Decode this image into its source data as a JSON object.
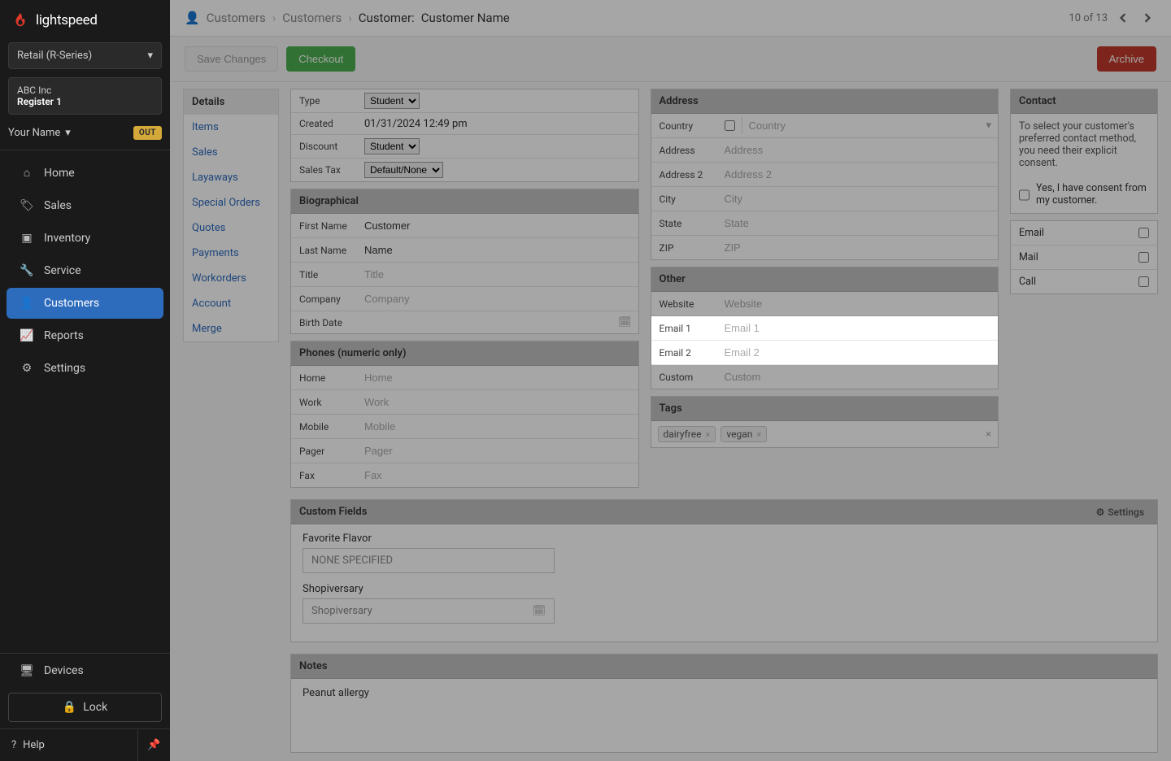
{
  "logo": "lightspeed",
  "retailSelect": "Retail (R-Series)",
  "store": "ABC Inc",
  "register": "Register 1",
  "userName": "Your Name",
  "outBadge": "OUT",
  "nav": {
    "home": "Home",
    "sales": "Sales",
    "inventory": "Inventory",
    "service": "Service",
    "customers": "Customers",
    "reports": "Reports",
    "settings": "Settings",
    "devices": "Devices",
    "lock": "Lock",
    "help": "Help"
  },
  "breadcrumb": {
    "a": "Customers",
    "b": "Customers",
    "c": "Customer:",
    "d": "Customer Name",
    "count": "10 of 13"
  },
  "toolbar": {
    "save": "Save Changes",
    "checkout": "Checkout",
    "archive": "Archive"
  },
  "subnav": {
    "details": "Details",
    "items": "Items",
    "sales": "Sales",
    "layaways": "Layaways",
    "special": "Special Orders",
    "quotes": "Quotes",
    "payments": "Payments",
    "workorders": "Workorders",
    "account": "Account",
    "merge": "Merge"
  },
  "panels": {
    "bio": "Biographical",
    "phones": "Phones (numeric only)",
    "address": "Address",
    "other": "Other",
    "tags": "Tags",
    "contact": "Contact",
    "custom": "Custom Fields",
    "settingsLabel": "Settings",
    "notes": "Notes"
  },
  "labels": {
    "type": "Type",
    "created": "Created",
    "discount": "Discount",
    "salestax": "Sales Tax",
    "firstname": "First Name",
    "lastname": "Last Name",
    "title": "Title",
    "company": "Company",
    "birth": "Birth Date",
    "home": "Home",
    "work": "Work",
    "mobile": "Mobile",
    "pager": "Pager",
    "fax": "Fax",
    "country": "Country",
    "address": "Address",
    "address2": "Address 2",
    "city": "City",
    "state": "State",
    "zip": "ZIP",
    "website": "Website",
    "email1": "Email 1",
    "email2": "Email 2",
    "custom": "Custom",
    "fav": "Favorite Flavor",
    "shop": "Shopiversary"
  },
  "values": {
    "typeOpt": "Student",
    "created": "01/31/2024 12:49 pm",
    "discountOpt": "Student",
    "salestaxOpt": "Default/None",
    "firstname": "Customer",
    "lastname": "Name",
    "favPlaceholder": "NONE SPECIFIED",
    "shopPlaceholder": "Shopiversary"
  },
  "placeholders": {
    "title": "Title",
    "company": "Company",
    "home": "Home",
    "work": "Work",
    "mobile": "Mobile",
    "pager": "Pager",
    "fax": "Fax",
    "country": "Country",
    "address": "Address",
    "address2": "Address 2",
    "city": "City",
    "state": "State",
    "zip": "ZIP",
    "website": "Website",
    "email1": "Email 1",
    "email2": "Email 2",
    "custom": "Custom"
  },
  "tags": {
    "a": "dairyfree",
    "b": "vegan"
  },
  "contact": {
    "instr": "To select your customer's preferred contact method, you need their explicit consent.",
    "consent": "Yes, I have consent from my customer.",
    "email": "Email",
    "mail": "Mail",
    "call": "Call"
  },
  "notes": "Peanut allergy"
}
